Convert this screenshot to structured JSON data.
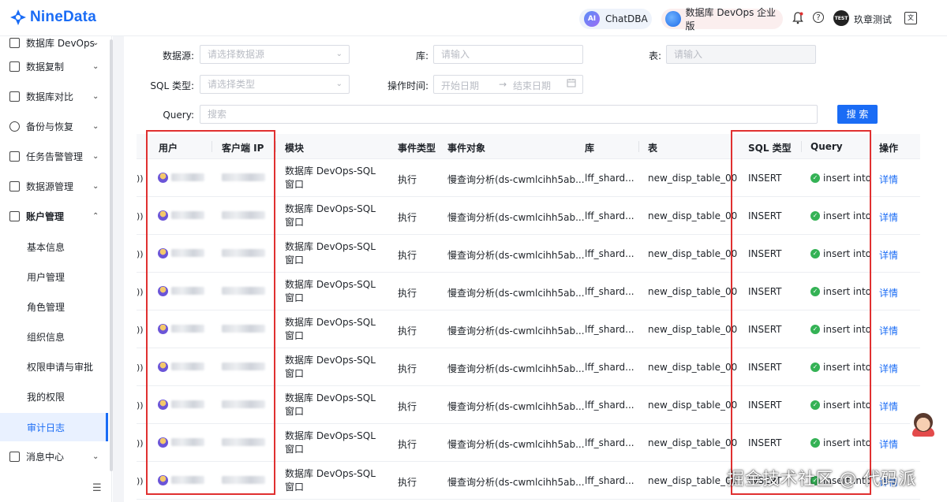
{
  "header": {
    "logo_text": "NineData",
    "chatdba_label": "ChatDBA",
    "edition_label": "数据库 DevOps 企业版",
    "avatar_label": "TEST",
    "user_name": "玖章测试"
  },
  "sidebar": {
    "items": [
      {
        "label": "数据库 DevOps",
        "icon": "devops-icon"
      },
      {
        "label": "数据复制",
        "icon": "copy-icon"
      },
      {
        "label": "数据库对比",
        "icon": "compare-icon"
      },
      {
        "label": "备份与恢复",
        "icon": "backup-icon"
      },
      {
        "label": "任务告警管理",
        "icon": "alarm-icon"
      },
      {
        "label": "数据源管理",
        "icon": "datasource-icon"
      },
      {
        "label": "账户管理",
        "icon": "account-icon"
      }
    ],
    "sub_items": [
      "基本信息",
      "用户管理",
      "角色管理",
      "组织信息",
      "权限申请与审批",
      "我的权限",
      "审计日志"
    ],
    "bottom_item": {
      "label": "消息中心",
      "icon": "mail-icon"
    }
  },
  "filters": {
    "datasource_label": "数据源:",
    "datasource_placeholder": "请选择数据源",
    "db_label": "库:",
    "db_placeholder": "请输入",
    "table_label": "表:",
    "table_placeholder": "请输入",
    "sqltype_label": "SQL 类型:",
    "sqltype_placeholder": "请选择类型",
    "optime_label": "操作时间:",
    "start_date": "开始日期",
    "end_date": "结束日期",
    "query_label": "Query:",
    "query_placeholder": "搜索",
    "search_button": "搜 索"
  },
  "table": {
    "columns": [
      "用户",
      "客户端 IP",
      "模块",
      "事件类型",
      "事件对象",
      "库",
      "表",
      "SQL 类型",
      "Query",
      "操作"
    ],
    "rows": [
      {
        "module": "数据库 DevOps-SQL 窗口",
        "event_type": "执行",
        "event_object": "慢查询分析(ds-cwmlcihh5ab...",
        "db": "lff_shard...",
        "table": "new_disp_table_00",
        "sql_type": "INSERT",
        "query": "insert into r",
        "action": "详情"
      },
      {
        "module": "数据库 DevOps-SQL 窗口",
        "event_type": "执行",
        "event_object": "慢查询分析(ds-cwmlcihh5ab...",
        "db": "lff_shard...",
        "table": "new_disp_table_00",
        "sql_type": "INSERT",
        "query": "insert into r",
        "action": "详情"
      },
      {
        "module": "数据库 DevOps-SQL 窗口",
        "event_type": "执行",
        "event_object": "慢查询分析(ds-cwmlcihh5ab...",
        "db": "lff_shard...",
        "table": "new_disp_table_00",
        "sql_type": "INSERT",
        "query": "insert into r",
        "action": "详情"
      },
      {
        "module": "数据库 DevOps-SQL 窗口",
        "event_type": "执行",
        "event_object": "慢查询分析(ds-cwmlcihh5ab...",
        "db": "lff_shard...",
        "table": "new_disp_table_00",
        "sql_type": "INSERT",
        "query": "insert into r",
        "action": "详情"
      },
      {
        "module": "数据库 DevOps-SQL 窗口",
        "event_type": "执行",
        "event_object": "慢查询分析(ds-cwmlcihh5ab...",
        "db": "lff_shard...",
        "table": "new_disp_table_00",
        "sql_type": "INSERT",
        "query": "insert into r",
        "action": "详情"
      },
      {
        "module": "数据库 DevOps-SQL 窗口",
        "event_type": "执行",
        "event_object": "慢查询分析(ds-cwmlcihh5ab...",
        "db": "lff_shard...",
        "table": "new_disp_table_00",
        "sql_type": "INSERT",
        "query": "insert into r",
        "action": "详情"
      },
      {
        "module": "数据库 DevOps-SQL 窗口",
        "event_type": "执行",
        "event_object": "慢查询分析(ds-cwmlcihh5ab...",
        "db": "lff_shard...",
        "table": "new_disp_table_00",
        "sql_type": "INSERT",
        "query": "insert into r",
        "action": "详情"
      },
      {
        "module": "数据库 DevOps-SQL 窗口",
        "event_type": "执行",
        "event_object": "慢查询分析(ds-cwmlcihh5ab...",
        "db": "lff_shard...",
        "table": "new_disp_table_00",
        "sql_type": "INSERT",
        "query": "insert into r",
        "action": "详情"
      },
      {
        "module": "数据库 DevOps-SQL 窗口",
        "event_type": "执行",
        "event_object": "慢查询分析(ds-cwmlcihh5ab...",
        "db": "lff_shard...",
        "table": "new_disp_table_00",
        "sql_type": "INSERT",
        "query": "insert into r",
        "action": "详情"
      }
    ]
  },
  "watermark": "掘金技术社区 @ 代码派",
  "colors": {
    "accent": "#1a6cf5",
    "highlight_box": "#e03030",
    "success": "#34b255"
  }
}
